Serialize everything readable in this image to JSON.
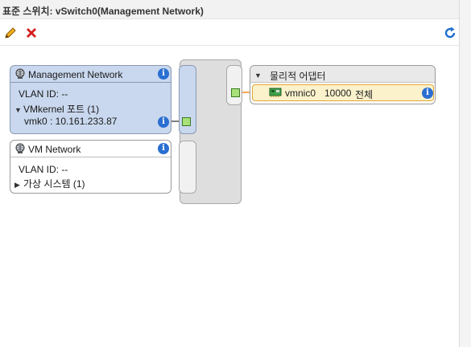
{
  "header": {
    "title": "표준 스위치: vSwitch0(Management Network)"
  },
  "toolbar": {
    "edit_icon": "pencil-icon",
    "remove_icon": "red-x-icon",
    "refresh_icon": "refresh-icon"
  },
  "port_groups": [
    {
      "name": "Management Network",
      "vlan": "VLAN ID: --",
      "section": "VMkernel 포트 (1)",
      "adapter": "vmk0 : 10.161.233.87"
    },
    {
      "name": "VM Network",
      "vlan": "VLAN ID: --",
      "section": "가상 시스템 (1)"
    }
  ],
  "physical_adapters": {
    "title": "물리적 어댑터",
    "nic": {
      "name": "vmnic0",
      "speed": "10000",
      "duplex": "전체"
    }
  },
  "colors": {
    "selected_bg": "#c9d8ee",
    "info_blue": "#2a6fd1",
    "active_link": "#f08a1c",
    "nic_highlight": "#fbf2cc",
    "connector_green": "#a8e07a"
  }
}
